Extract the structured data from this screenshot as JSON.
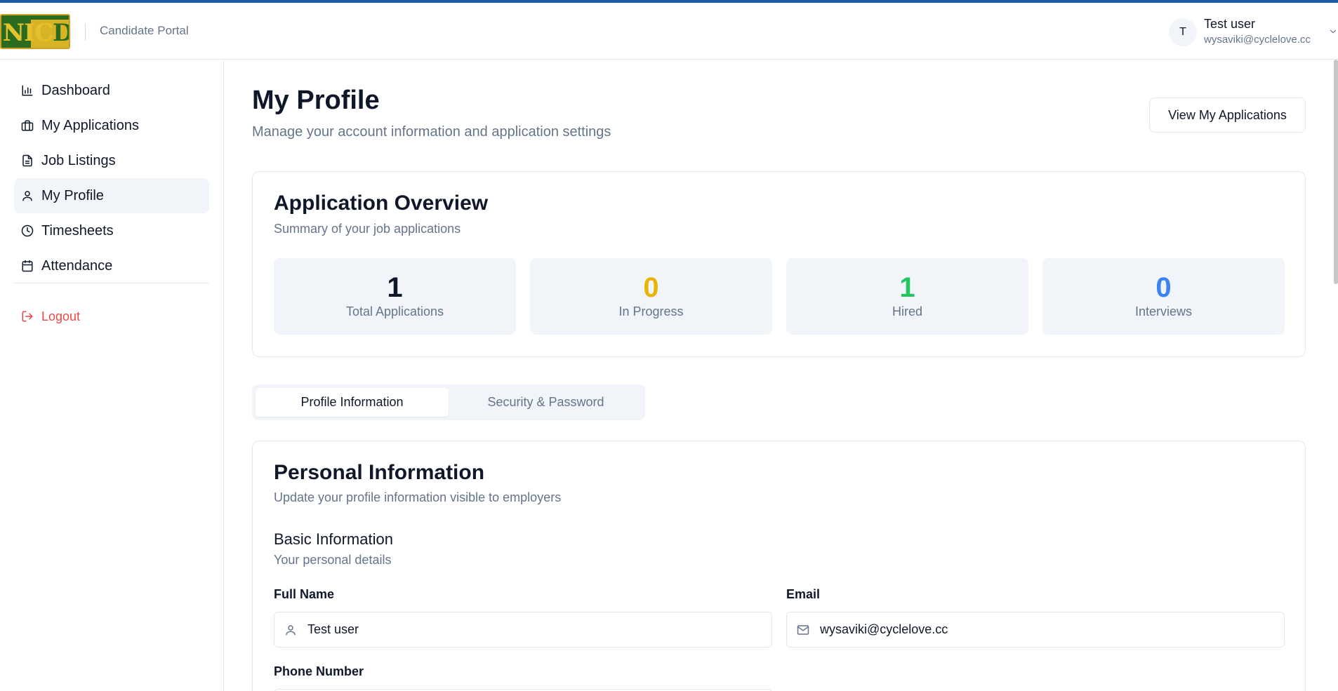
{
  "header": {
    "logo_text_a": "NIC",
    "logo_text_b": "DIK",
    "portal_name": "Candidate Portal",
    "user": {
      "avatar_initial": "T",
      "name": "Test user",
      "email": "wysaviki@cyclelove.cc"
    }
  },
  "sidebar": {
    "items": [
      {
        "label": "Dashboard",
        "icon": "bar-chart-icon"
      },
      {
        "label": "My Applications",
        "icon": "briefcase-icon"
      },
      {
        "label": "Job Listings",
        "icon": "document-icon"
      },
      {
        "label": "My Profile",
        "icon": "user-icon",
        "active": true
      },
      {
        "label": "Timesheets",
        "icon": "clock-icon"
      },
      {
        "label": "Attendance",
        "icon": "calendar-icon"
      }
    ],
    "logout_label": "Logout"
  },
  "main": {
    "title": "My Profile",
    "subtitle": "Manage your account information and application settings",
    "view_applications_label": "View My Applications",
    "overview": {
      "title": "Application Overview",
      "subtitle": "Summary of your job applications",
      "stats": [
        {
          "value": "1",
          "label": "Total Applications",
          "color": "#0f172a"
        },
        {
          "value": "0",
          "label": "In Progress",
          "color": "#eab308"
        },
        {
          "value": "1",
          "label": "Hired",
          "color": "#22c55e"
        },
        {
          "value": "0",
          "label": "Interviews",
          "color": "#3b82f6"
        }
      ]
    },
    "tabs": [
      {
        "label": "Profile Information",
        "active": true
      },
      {
        "label": "Security & Password",
        "active": false
      }
    ],
    "personal": {
      "title": "Personal Information",
      "subtitle": "Update your profile information visible to employers",
      "section_title": "Basic Information",
      "section_subtitle": "Your personal details",
      "full_name_label": "Full Name",
      "full_name_value": "Test user",
      "email_label": "Email",
      "email_value": "wysaviki@cyclelove.cc",
      "phone_label": "Phone Number"
    }
  },
  "colors": {
    "accent_topline": "#1e5aa8",
    "logout": "#ef4444",
    "active_nav_bg": "#f1f5f9"
  }
}
